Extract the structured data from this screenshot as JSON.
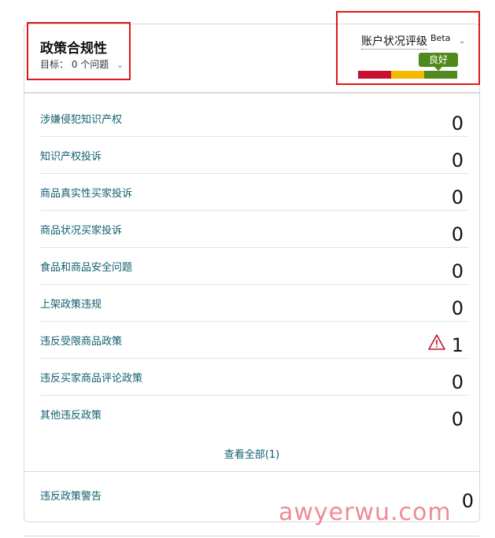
{
  "header": {
    "title": "政策合规性",
    "target_text": "目标：  0 个问题",
    "chevron": "⌄"
  },
  "health": {
    "label": "账户状况评级",
    "beta": "Beta",
    "status": "良好",
    "colors": {
      "red": "#c8102e",
      "yellow": "#f5b800",
      "green": "#508a1e"
    }
  },
  "rows": [
    {
      "label": "涉嫌侵犯知识产权",
      "count": "0"
    },
    {
      "label": "知识产权投诉",
      "count": "0"
    },
    {
      "label": "商品真实性买家投诉",
      "count": "0"
    },
    {
      "label": "商品状况买家投诉",
      "count": "0"
    },
    {
      "label": "食品和商品安全问题",
      "count": "0"
    },
    {
      "label": "上架政策违规",
      "count": "0"
    },
    {
      "label": "违反受限商品政策",
      "count": "1"
    },
    {
      "label": "违反买家商品评论政策",
      "count": "0"
    },
    {
      "label": "其他违反政策",
      "count": "0"
    }
  ],
  "view_all": "查看全部(1)",
  "warnings": {
    "label": "违反政策警告",
    "count": "0"
  },
  "watermark": "awyerwu.com"
}
